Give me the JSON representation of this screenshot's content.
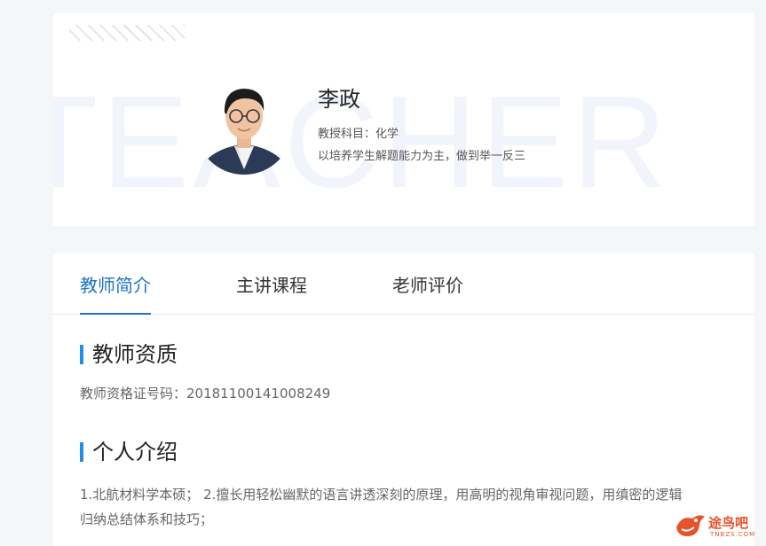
{
  "hero": {
    "watermark": "TEACHER",
    "teacher": {
      "name": "李政",
      "subject": "教授科目：化学",
      "motto": "以培养学生解题能力为主，做到举一反三"
    }
  },
  "tabs": [
    {
      "label": "教师简介",
      "active": true
    },
    {
      "label": "主讲课程",
      "active": false
    },
    {
      "label": "老师评价",
      "active": false
    }
  ],
  "qualification": {
    "title": "教师资质",
    "certificate": "教师资格证号码：20181100141008249"
  },
  "introduction": {
    "title": "个人介绍",
    "line1": "1.北航材料学本硕； 2.擅长用轻松幽默的语言讲透深刻的原理，用高明的视角审视问题，用缜密的逻辑",
    "line2": "归纳总结体系和技巧；"
  },
  "logo": {
    "text": "途鸟吧",
    "subtext": "TNBZS.COM"
  },
  "colors": {
    "accent": "#1e74c5",
    "bar": "#1e8ee6",
    "logo": "#e7522a"
  }
}
